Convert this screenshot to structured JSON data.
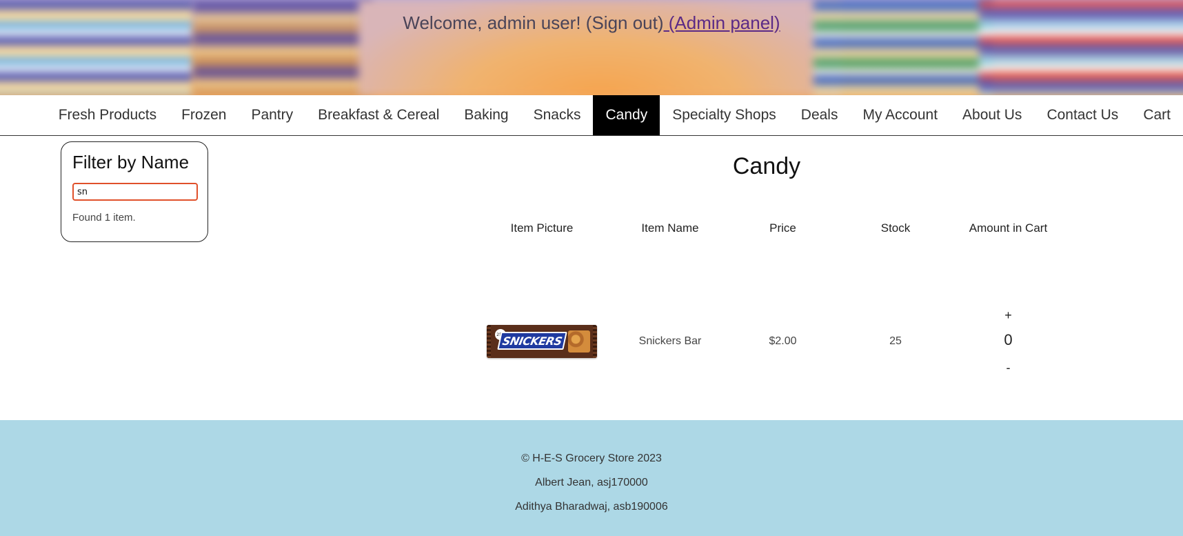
{
  "header": {
    "welcome_text": "Welcome, admin user! (Sign out)",
    "admin_link": " (Admin panel)"
  },
  "nav": {
    "items": [
      {
        "label": "Fresh Products"
      },
      {
        "label": "Frozen"
      },
      {
        "label": "Pantry"
      },
      {
        "label": "Breakfast & Cereal"
      },
      {
        "label": "Baking"
      },
      {
        "label": "Snacks"
      },
      {
        "label": "Candy",
        "active": true
      },
      {
        "label": "Specialty Shops"
      },
      {
        "label": "Deals"
      },
      {
        "label": "My Account"
      },
      {
        "label": "About Us"
      },
      {
        "label": "Contact Us"
      },
      {
        "label": "Cart"
      }
    ]
  },
  "filter": {
    "title": "Filter by Name",
    "input_value": "sn",
    "result_text": "Found 1 item."
  },
  "page_title": "Candy",
  "table": {
    "headers": [
      "Item Picture",
      "Item Name",
      "Price",
      "Stock",
      "Amount in Cart"
    ],
    "rows": [
      {
        "image": "snickers-bar-image",
        "image_logo_text": "SNICKERS",
        "name": "Snickers Bar",
        "price": "$2.00",
        "stock": "25",
        "amount": "0",
        "plus": "+",
        "minus": "-"
      }
    ]
  },
  "footer": {
    "copyright": "© H-E-S Grocery Store 2023",
    "author1": "Albert Jean, asj170000",
    "author2": "Adithya Bharadwaj, asb190006"
  },
  "colors": {
    "accent_active": "#000000",
    "footer_bg": "#add8e6",
    "input_focus_border": "#e0502a",
    "admin_link": "#5b2a86"
  }
}
